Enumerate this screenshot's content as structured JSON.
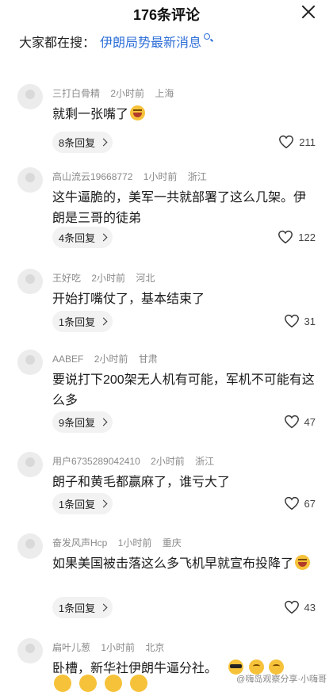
{
  "header": {
    "title": "176条评论"
  },
  "search": {
    "prefix": "大家都在搜：",
    "link": "伊朗局势最新消息"
  },
  "comments": [
    {
      "user": "三打白骨精",
      "time": "2小时前",
      "location": "上海",
      "text": "就剩一张嘴了",
      "emoji": "laugh-icon",
      "replies": "8条回复",
      "likes": "211"
    },
    {
      "user": "高山流云19668772",
      "time": "1小时前",
      "location": "浙江",
      "text": "这牛逼脆的，美军一共就部署了这么几架。伊朗是三哥的徒弟",
      "replies": "4条回复",
      "likes": "122"
    },
    {
      "user": "王好吃",
      "time": "2小时前",
      "location": "河北",
      "text": "开始打嘴仗了，基本结束了",
      "replies": "1条回复",
      "likes": "31"
    },
    {
      "user": "AABEF",
      "time": "2小时前",
      "location": "甘肃",
      "text": "要说打下200架无人机有可能，军机不可能有这么多",
      "replies": "9条回复",
      "likes": "47"
    },
    {
      "user": "用户6735289042410",
      "time": "2小时前",
      "location": "浙江",
      "text": "朗子和黄毛都赢麻了，谁亏大了",
      "replies": "1条回复",
      "likes": "67"
    },
    {
      "user": "奋发风声Hcp",
      "time": "1小时前",
      "location": "重庆",
      "text": "如果美国被击落这么多飞机早就宣布投降了",
      "emoji": "laugh-icon",
      "replies": "1条回复",
      "likes": "43"
    },
    {
      "user": "扁叶儿葱",
      "time": "1小时前",
      "location": "北京",
      "text": "卧槽，新华社伊朗牛逼分社。"
    }
  ],
  "watermark": "@嗨岛观察分享·小嗨哥",
  "colors": {
    "link": "#2e6fd8",
    "meta": "#8a8a8a",
    "pill": "#f2f2f2"
  }
}
